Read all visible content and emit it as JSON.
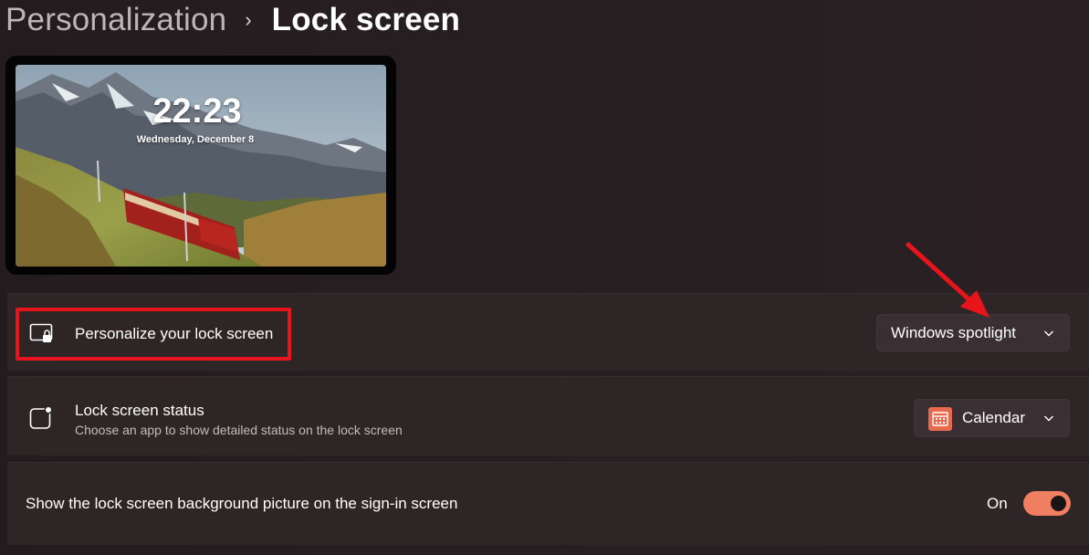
{
  "breadcrumb": {
    "parent": "Personalization",
    "separator": "›",
    "current": "Lock screen"
  },
  "preview": {
    "time": "22:23",
    "date": "Wednesday, December 8"
  },
  "settings": {
    "personalize": {
      "title": "Personalize your lock screen",
      "icon": "lock-screen-picture-icon",
      "dropdown_value": "Windows spotlight"
    },
    "status": {
      "title": "Lock screen status",
      "description": "Choose an app to show detailed status on the lock screen",
      "icon": "lock-screen-status-icon",
      "dropdown_value": "Calendar",
      "dropdown_icon": "calendar-icon"
    },
    "signin_background": {
      "title": "Show the lock screen background picture on the sign-in screen",
      "toggle_label": "On",
      "toggle_on": true
    }
  },
  "colors": {
    "accent": "#f07e61",
    "annotation_red": "#e8141b"
  }
}
